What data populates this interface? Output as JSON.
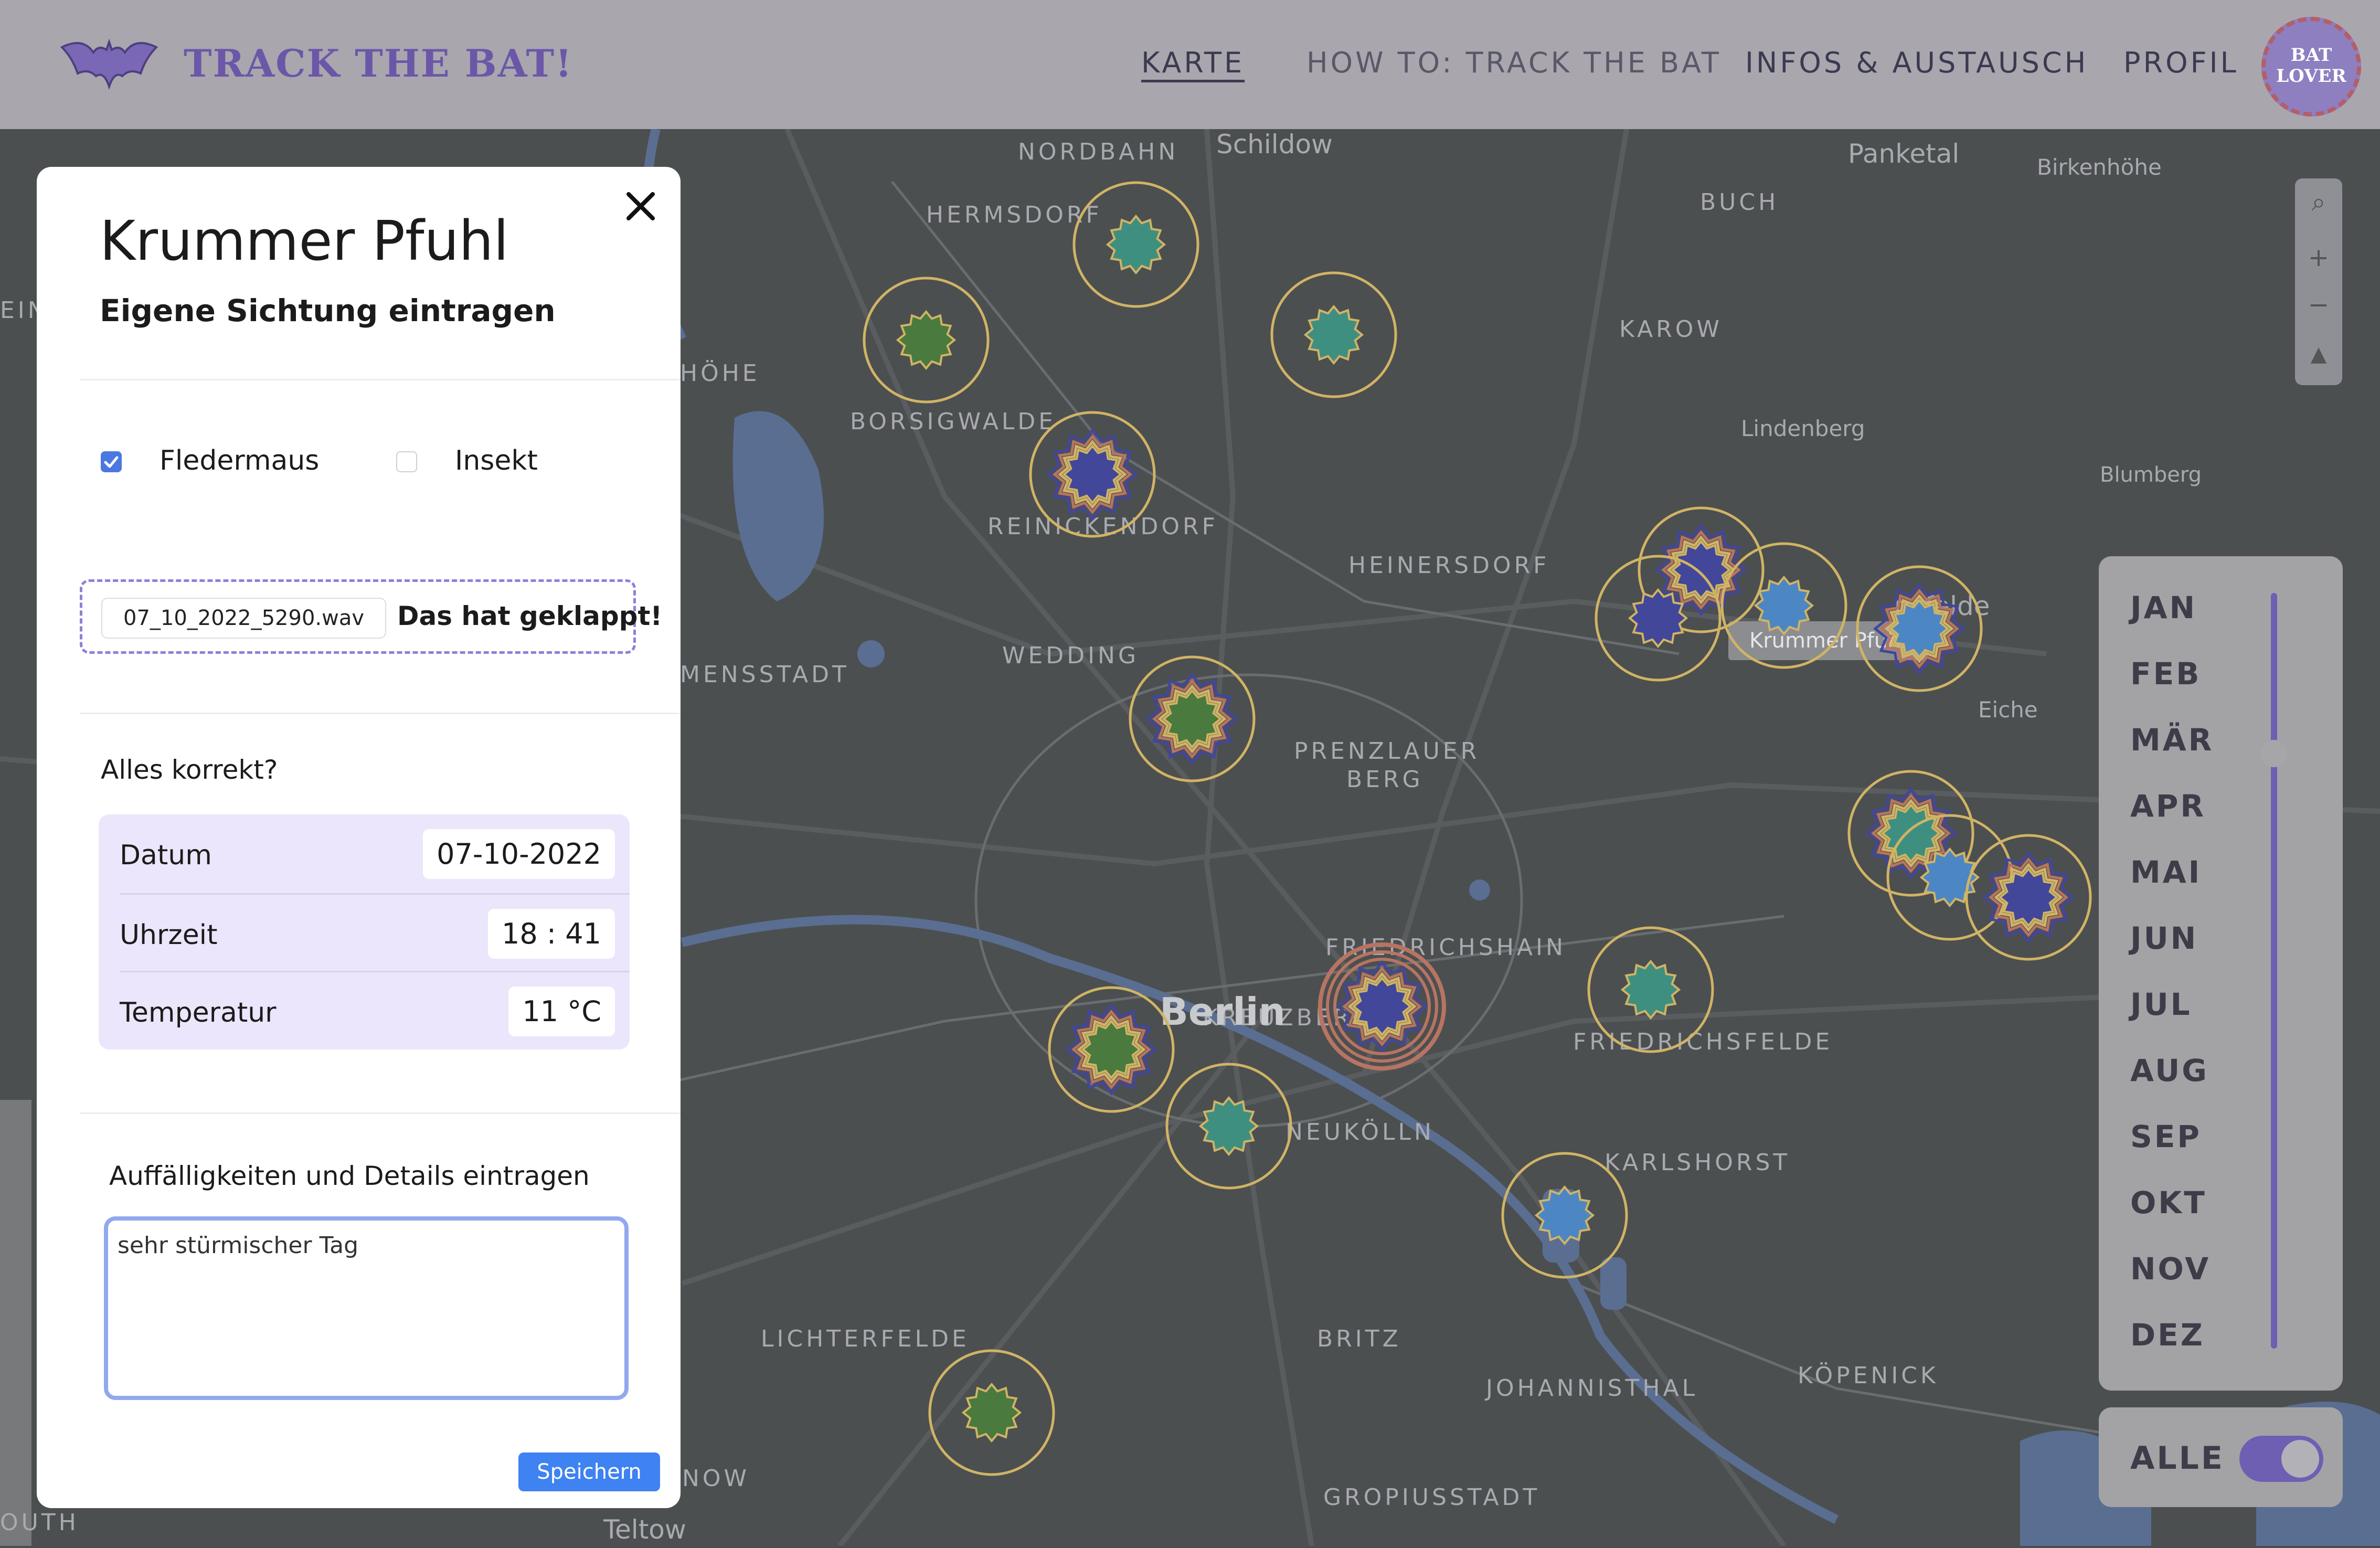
{
  "header": {
    "logo_text": "TRACK THE BAT!",
    "nav": [
      "KARTE",
      "HOW TO: TRACK THE BAT",
      "INFOS & AUSTAUSCH",
      "PROFIL"
    ],
    "avatar_line1": "BAT",
    "avatar_line2": "LOVER"
  },
  "map": {
    "city": "Berlin",
    "tooltip": "Krummer Pfuhl",
    "districts": [
      "NORDBAHN",
      "HERMSDORF",
      "BORSIGWALDE",
      "REINICKENDORF",
      "WEDDING",
      "MENSSTADT",
      "HÖHE",
      "HEINERSDORF",
      "KAROW",
      "BUCH",
      "PRENZLAUER",
      "BERG",
      "FRIEDRICHSHAIN",
      "KREUZBERG",
      "NEUKÖLLN",
      "FRIEDRICHSFELDE",
      "KARLSHORST",
      "LICHTERFELDE",
      "BRITZ",
      "JOHANNISTHAL",
      "KÖPENICK",
      "GROPIUSSTADT",
      "NOW",
      "OUTH",
      "EIN"
    ],
    "places": [
      "Schildow",
      "Panketal",
      "Birkenhöhe",
      "Lindenberg",
      "Blumberg",
      "Eiche",
      "nsfelde",
      "Teltow"
    ],
    "marker_colors": [
      "#3f8f80",
      "#4a7a3e",
      "#42479a",
      "#4c87c4",
      "#d0b465",
      "#b87462"
    ]
  },
  "months": [
    "JAN",
    "FEB",
    "MÄR",
    "APR",
    "MAI",
    "JUN",
    "JUL",
    "AUG",
    "SEP",
    "OKT",
    "NOV",
    "DEZ"
  ],
  "month_filter_value": 0.25,
  "alle": {
    "label": "ALLE",
    "on": true
  },
  "modal": {
    "title": "Krummer Pfuhl",
    "subtitle": "Eigene Sichtung eintragen",
    "checkbox_fledermaus": {
      "label": "Fledermaus",
      "checked": true
    },
    "checkbox_insekt": {
      "label": "Insekt",
      "checked": false
    },
    "file_name": "07_10_2022_5290.wav",
    "file_status": "Das hat geklappt!",
    "confirm_label": "Alles korrekt?",
    "details": [
      {
        "label": "Datum",
        "value": "07-10-2022"
      },
      {
        "label": "Uhrzeit",
        "value": "18 : 41"
      },
      {
        "label": "Temperatur",
        "value": "11 °C"
      }
    ],
    "notes_label": "Auffälligkeiten und Details eintragen",
    "notes_value": "sehr stürmischer Tag",
    "save_label": "Speichern"
  }
}
